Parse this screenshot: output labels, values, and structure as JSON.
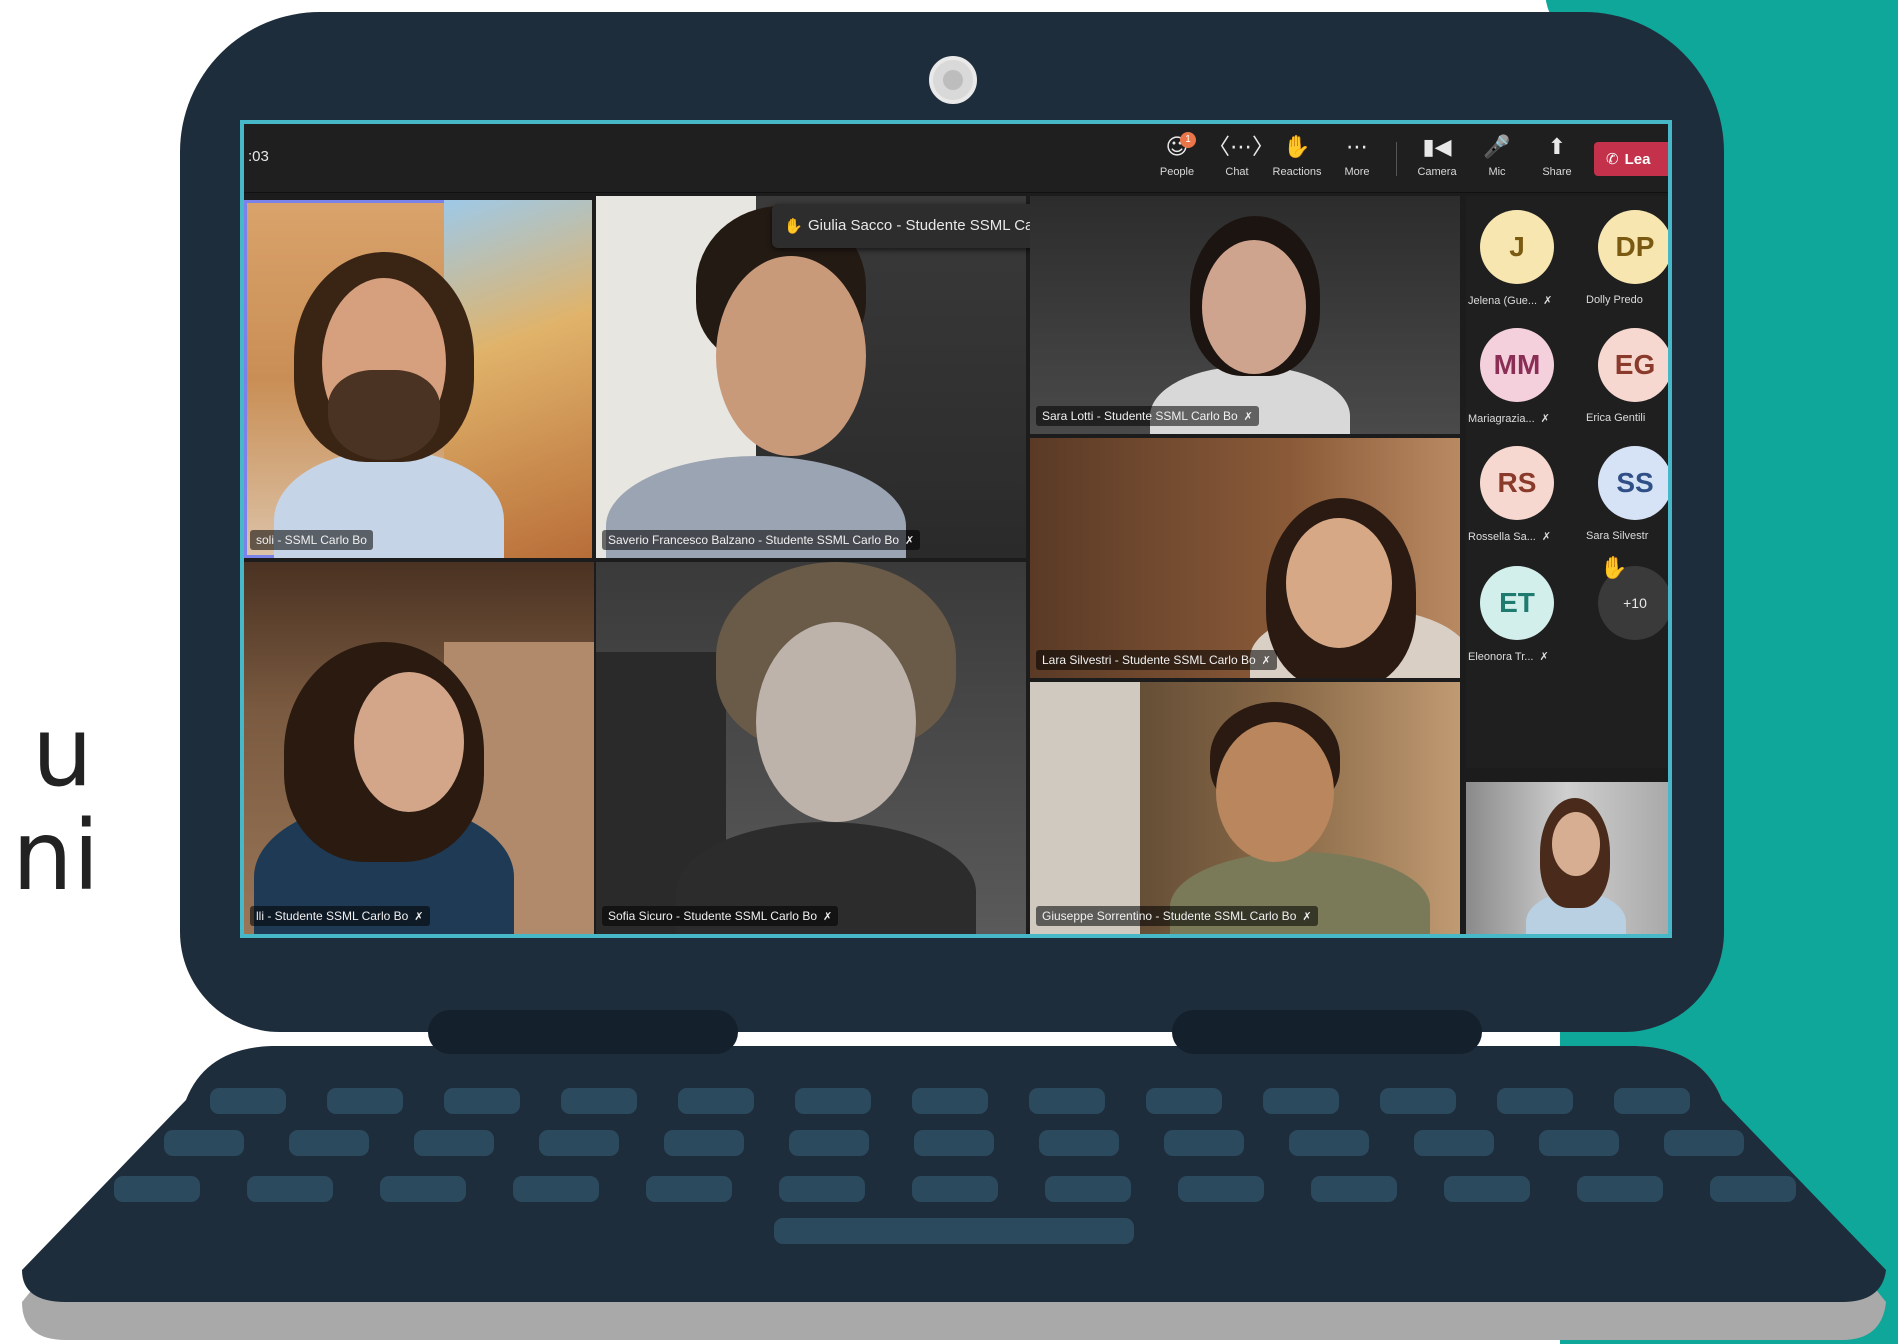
{
  "side_text": [
    "u",
    "ni"
  ],
  "meeting": {
    "timer": ":03",
    "toolbar": {
      "people": {
        "label": "People",
        "badge": "1",
        "icon": "people-icon"
      },
      "chat": {
        "label": "Chat",
        "icon": "chat-icon"
      },
      "reactions": {
        "label": "Reactions",
        "icon": "reactions-icon"
      },
      "more": {
        "label": "More",
        "icon": "more-icon"
      },
      "camera": {
        "label": "Camera",
        "icon": "camera-icon"
      },
      "mic": {
        "label": "Mic",
        "icon": "mic-icon"
      },
      "share": {
        "label": "Share",
        "icon": "share-icon"
      },
      "leave": {
        "label": "Lea",
        "icon": "phone-icon",
        "color": "#c4314b"
      }
    },
    "raised_hand_notice": "Giulia Sacco - Studente SSML Carlo Bo",
    "tiles": [
      {
        "name": "soli - SSML Carlo Bo",
        "muted": false
      },
      {
        "name": "Saverio Francesco Balzano - Studente SSML Carlo Bo",
        "muted": true
      },
      {
        "name": "Sara Lotti - Studente SSML Carlo Bo",
        "muted": true
      },
      {
        "name": "Lara Silvestri - Studente SSML Carlo Bo",
        "muted": true
      },
      {
        "name": "lli - Studente SSML Carlo Bo",
        "muted": true
      },
      {
        "name": "Sofia Sicuro - Studente SSML Carlo Bo",
        "muted": true
      },
      {
        "name": "Giuseppe Sorrentino - Studente SSML Carlo Bo",
        "muted": true
      }
    ],
    "roster": [
      {
        "initials": "J",
        "name": "Jelena (Gue...",
        "muted": true,
        "bg": "#f7e6b0",
        "fg": "#7a5a10"
      },
      {
        "initials": "DP",
        "name": "Dolly Predo",
        "muted": false,
        "bg": "#f7e6b0",
        "fg": "#7a5a10"
      },
      {
        "initials": "MM",
        "name": "Mariagrazia...",
        "muted": true,
        "bg": "#f4d0dc",
        "fg": "#8a2e55"
      },
      {
        "initials": "EG",
        "name": "Erica Gentili",
        "muted": false,
        "bg": "#f6d8d0",
        "fg": "#8a3a2a"
      },
      {
        "initials": "RS",
        "name": "Rossella Sa...",
        "muted": true,
        "bg": "#f6d8d0",
        "fg": "#8a3a2a"
      },
      {
        "initials": "SS",
        "name": "Sara Silvestr",
        "muted": false,
        "bg": "#d6e2f5",
        "fg": "#2f4f86"
      },
      {
        "initials": "ET",
        "name": "Eleonora Tr...",
        "muted": true,
        "bg": "#d3efec",
        "fg": "#1f7a70"
      }
    ],
    "overflow_count": "+10",
    "colors": {
      "accent": "#7b83eb",
      "screen_border": "#46b8c8",
      "teal_bg": "#0fa79a"
    }
  }
}
